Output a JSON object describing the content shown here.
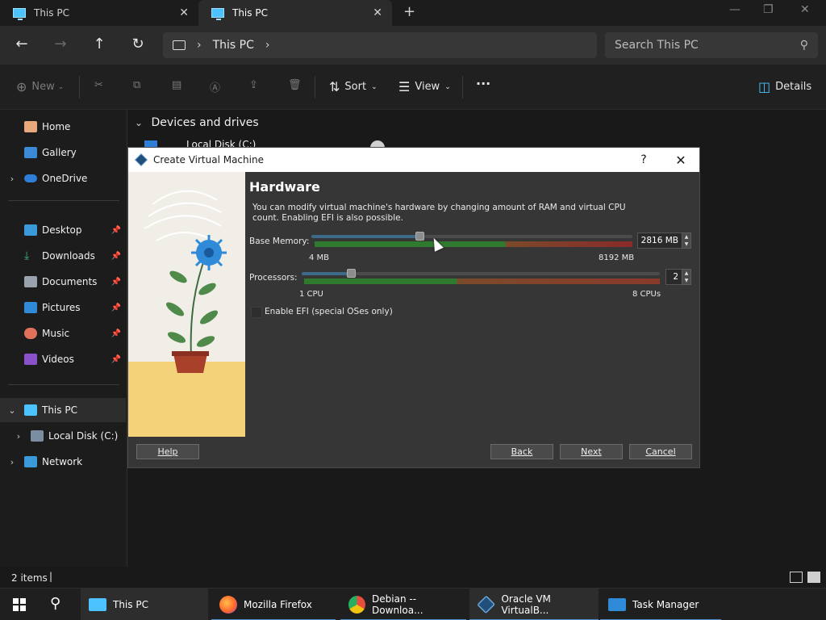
{
  "explorer": {
    "tabs": [
      {
        "label": "This PC"
      },
      {
        "label": "This PC"
      }
    ],
    "new_tab_glyph": "+",
    "address": {
      "crumbs": [
        "This PC"
      ]
    },
    "search": {
      "placeholder": "Search This PC"
    },
    "commands": {
      "new_label": "New",
      "sort_label": "Sort",
      "view_label": "View",
      "more_glyph": "···",
      "details_label": "Details"
    },
    "sidebar": {
      "items": [
        {
          "label": "Home"
        },
        {
          "label": "Gallery"
        },
        {
          "label": "OneDrive"
        },
        {
          "label": "Desktop"
        },
        {
          "label": "Downloads"
        },
        {
          "label": "Documents"
        },
        {
          "label": "Pictures"
        },
        {
          "label": "Music"
        },
        {
          "label": "Videos"
        },
        {
          "label": "This PC"
        },
        {
          "label": "Local Disk (C:)"
        },
        {
          "label": "Network"
        }
      ]
    },
    "main": {
      "group_title": "Devices and drives",
      "drive_label": "Local Disk (C:)"
    },
    "status": {
      "item_count": "2 items"
    }
  },
  "dialog": {
    "title": "Create Virtual Machine",
    "help_glyph": "?",
    "heading": "Hardware",
    "description": "You can modify virtual machine's hardware by changing amount of RAM and virtual CPU count. Enabling EFI is also possible.",
    "memory": {
      "label": "Base Memory:",
      "min_label": "4 MB",
      "max_label": "8192 MB",
      "value": "2816 MB",
      "fraction": 0.34
    },
    "processors": {
      "label": "Processors:",
      "min_label": "1 CPU",
      "max_label": "8 CPUs",
      "value": "2",
      "fraction": 0.14
    },
    "efi_label": "Enable EFI (special OSes only)",
    "buttons": {
      "help": "Help",
      "back": "Back",
      "next": "Next",
      "cancel": "Cancel"
    }
  },
  "taskbar": {
    "items": [
      {
        "label": "This PC"
      },
      {
        "label": "Mozilla Firefox"
      },
      {
        "label": "Debian -- Downloa..."
      },
      {
        "label": "Oracle VM VirtualB..."
      },
      {
        "label": "Task Manager"
      }
    ]
  },
  "colors": {
    "accent": "#4cc2ff",
    "dialog_bg": "#363636",
    "scale_green": "#2f7a2f",
    "scale_red": "#8a3a2a"
  }
}
